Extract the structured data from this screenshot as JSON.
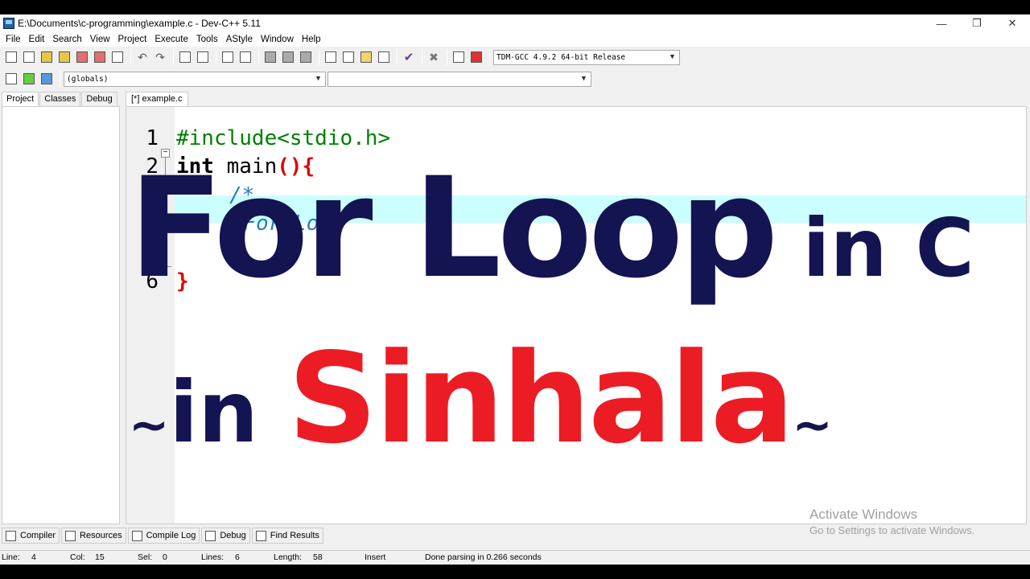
{
  "window": {
    "title": "E:\\Documents\\c-programming\\example.c - Dev-C++ 5.11",
    "controls": {
      "minimize": "—",
      "restore": "❐",
      "close": "✕"
    }
  },
  "menu": [
    "File",
    "Edit",
    "Search",
    "View",
    "Project",
    "Execute",
    "Tools",
    "AStyle",
    "Window",
    "Help"
  ],
  "toolbar": {
    "compiler_select": "TDM-GCC 4.9.2 64-bit Release",
    "scope_select": "(globals)",
    "member_select": ""
  },
  "left_tabs": [
    "Project",
    "Classes",
    "Debug"
  ],
  "editor": {
    "tab_label": "[*] example.c",
    "line_numbers": [
      "1",
      "2",
      "6"
    ],
    "line1": "#include<stdio.h>",
    "line2_kw": "int",
    "line2_id": " main",
    "line2_sym": "(){",
    "line3": "/*",
    "line4": "  For Loop",
    "line5": " *",
    "line6": "}"
  },
  "overlay": {
    "title_big": "For Loop",
    "title_mid": " in C",
    "tilde_left": "~",
    "sub_in": "in ",
    "sub_sinhala": "Sinhala",
    "tilde_right": "~"
  },
  "watermark": {
    "line1": "Activate Windows",
    "line2": "Go to Settings to activate Windows."
  },
  "bottom_tabs": [
    "Compiler",
    "Resources",
    "Compile Log",
    "Debug",
    "Find Results"
  ],
  "status": {
    "line_label": "Line:",
    "line_value": "4",
    "col_label": "Col:",
    "col_value": "15",
    "sel_label": "Sel:",
    "sel_value": "0",
    "lines_label": "Lines:",
    "lines_value": "6",
    "length_label": "Length:",
    "length_value": "58",
    "mode": "Insert",
    "message": "Done parsing in 0.266 seconds"
  }
}
